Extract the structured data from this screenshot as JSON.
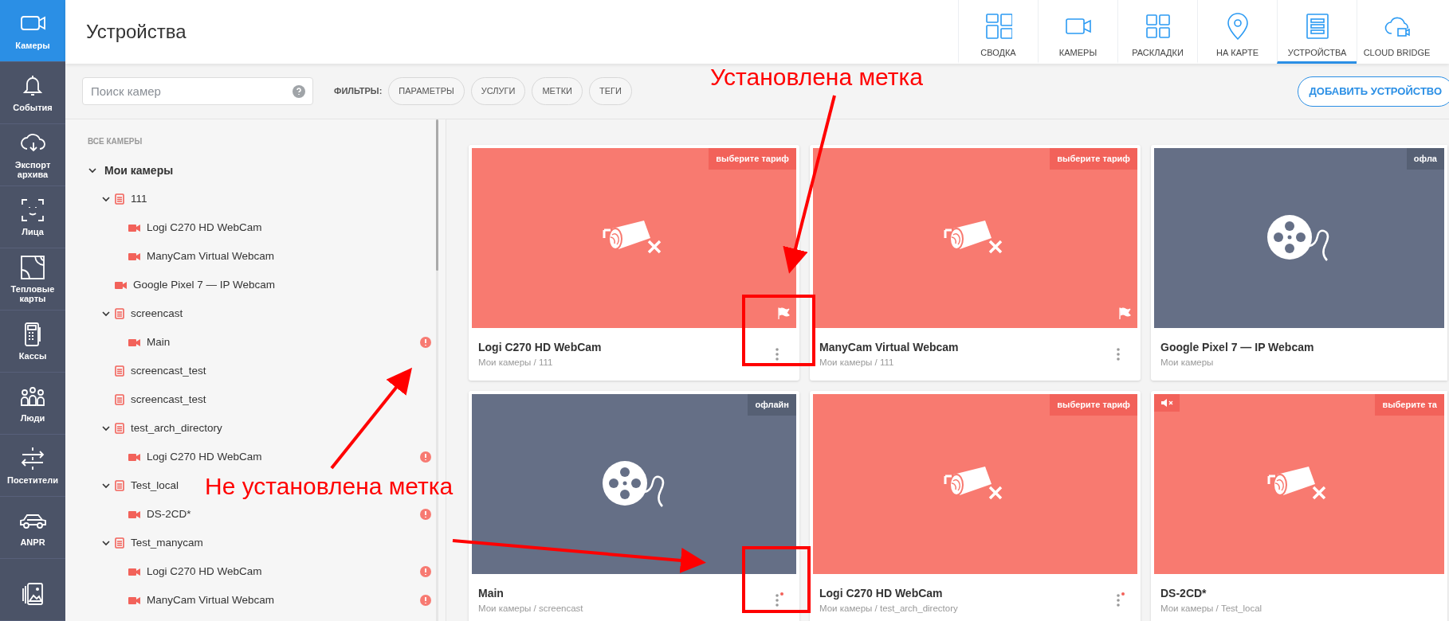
{
  "sidebar": {
    "items": [
      {
        "label": "Камеры",
        "selected": true
      },
      {
        "label": "События",
        "selected": false
      },
      {
        "label": "Экспорт архива",
        "selected": false
      },
      {
        "label": "Лица",
        "selected": false
      },
      {
        "label": "Тепловые карты",
        "selected": false
      },
      {
        "label": "Кассы",
        "selected": false
      },
      {
        "label": "Люди",
        "selected": false
      },
      {
        "label": "Посетители",
        "selected": false
      },
      {
        "label": "ANPR",
        "selected": false
      },
      {
        "selected": false
      }
    ]
  },
  "header": {
    "title": "Устройства",
    "tabs": [
      {
        "label": "СВОДКА",
        "selected": false
      },
      {
        "label": "КАМЕРЫ",
        "selected": false
      },
      {
        "label": "РАСКЛАДКИ",
        "selected": false
      },
      {
        "label": "НА КАРТЕ",
        "selected": false
      },
      {
        "label": "УСТРОЙСТВА",
        "selected": true
      },
      {
        "label": "CLOUD BRIDGE",
        "selected": false
      }
    ]
  },
  "filter_bar": {
    "search": {
      "placeholder": "Поиск камер"
    },
    "filters_label": "ФИЛЬТРЫ:",
    "filters": [
      "ПАРАМЕТРЫ",
      "УСЛУГИ",
      "МЕТКИ",
      "ТЕГИ"
    ],
    "add_button": "ДОБАВИТЬ УСТРОЙСТВО"
  },
  "tree": {
    "heading": "ВСЕ КАМЕРЫ",
    "items": [
      {
        "kind": "root",
        "label": "Мои камеры",
        "expanded": true,
        "children": [
          {
            "kind": "group",
            "label": "111",
            "expanded": true,
            "children": [
              {
                "kind": "camera",
                "label": "Logi C270 HD WebCam",
                "alert": false
              },
              {
                "kind": "camera",
                "label": "ManyCam Virtual Webcam",
                "alert": false
              }
            ]
          },
          {
            "kind": "camera",
            "label": "Google Pixel 7 — IP Webcam",
            "alert": false
          },
          {
            "kind": "group",
            "label": "screencast",
            "expanded": true,
            "children": [
              {
                "kind": "camera",
                "label": "Main",
                "alert": true
              }
            ]
          },
          {
            "kind": "group",
            "label": "screencast_test"
          },
          {
            "kind": "group",
            "label": "screencast_test"
          },
          {
            "kind": "group",
            "label": "test_arch_directory",
            "expanded": true,
            "children": [
              {
                "kind": "camera",
                "label": "Logi C270 HD WebCam",
                "alert": true
              }
            ]
          },
          {
            "kind": "group",
            "label": "Test_local",
            "expanded": true,
            "children": [
              {
                "kind": "camera",
                "label": "DS-2CD*",
                "alert": true
              }
            ]
          },
          {
            "kind": "group",
            "label": "Test_manycam",
            "expanded": true,
            "children": [
              {
                "kind": "camera",
                "label": "Logi C270 HD WebCam",
                "alert": true
              },
              {
                "kind": "camera",
                "label": "ManyCam Virtual Webcam",
                "alert": true
              }
            ]
          }
        ]
      }
    ]
  },
  "cards": [
    {
      "name": "Logi C270 HD WebCam",
      "path": "Мои камеры / 111",
      "kind": "tariff",
      "badge": "выберите тариф",
      "flagged": true,
      "marker": false,
      "muted": false
    },
    {
      "name": "ManyCam Virtual Webcam",
      "path": "Мои камеры / 111",
      "kind": "tariff",
      "badge": "выберите тариф",
      "flagged": true,
      "marker": false,
      "muted": false
    },
    {
      "name": "Google Pixel 7 — IP Webcam",
      "path": "Мои камеры",
      "kind": "offline",
      "badge": "офла",
      "flagged": false,
      "marker": false,
      "muted": false
    },
    {
      "name": "Main",
      "path": "Мои камеры / screencast",
      "kind": "offline",
      "badge": "офлайн",
      "flagged": false,
      "marker": true,
      "muted": false
    },
    {
      "name": "Logi C270 HD WebCam",
      "path": "Мои камеры / test_arch_directory",
      "kind": "tariff",
      "badge": "выберите тариф",
      "flagged": false,
      "marker": true,
      "muted": false
    },
    {
      "name": "DS-2CD*",
      "path": "Мои камеры / Test_local",
      "kind": "tariff",
      "badge": "выберите та",
      "flagged": false,
      "marker": false,
      "muted": true
    }
  ],
  "annotations": [
    {
      "kind": "label",
      "text": "Установлена метка"
    },
    {
      "kind": "label",
      "text": "Не установлена метка"
    }
  ]
}
